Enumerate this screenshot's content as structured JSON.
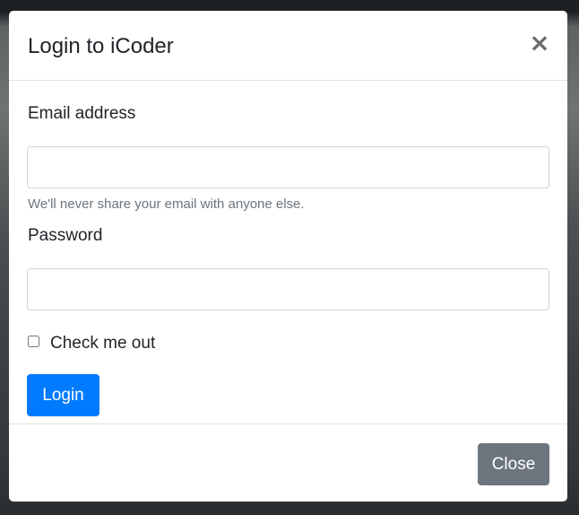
{
  "modal": {
    "title": "Login to iCoder",
    "close_icon": "×",
    "close_icon_name": "close-icon"
  },
  "form": {
    "email_label": "Email address",
    "email_value": "",
    "email_placeholder": "",
    "email_help": "We'll never share your email with anyone else.",
    "password_label": "Password",
    "password_value": "",
    "password_placeholder": "",
    "checkbox_label": "Check me out",
    "checkbox_checked": false,
    "submit_label": "Login"
  },
  "footer": {
    "close_label": "Close"
  },
  "colors": {
    "primary": "#007bff",
    "secondary": "#6c757d",
    "text": "#212529",
    "muted": "#6c757d",
    "border": "#dee2e6"
  }
}
